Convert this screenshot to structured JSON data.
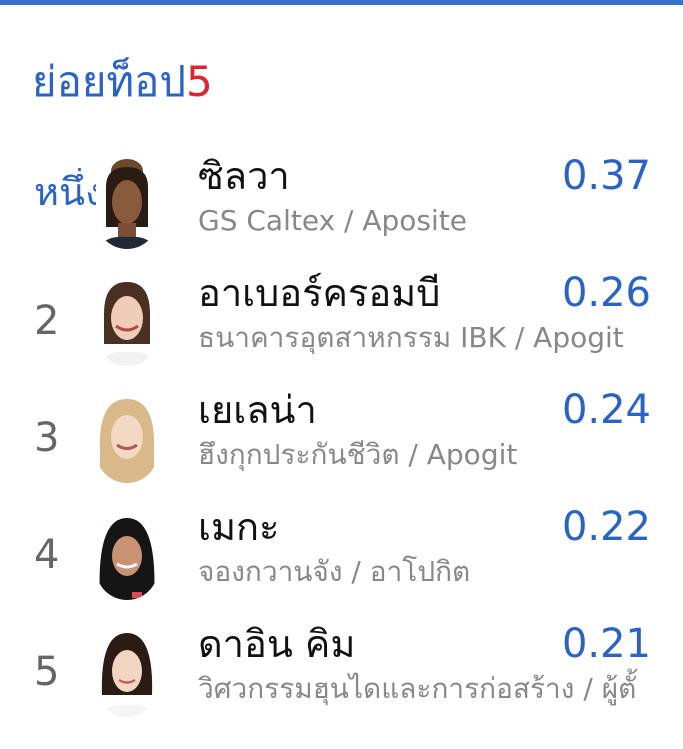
{
  "header": {
    "title": "ย่อยท็อป",
    "title_number": "5"
  },
  "rows": [
    {
      "rank": "หนึ่ง",
      "name": "ซิลวา",
      "team": "GS Caltex / Aposite",
      "value": "0.37"
    },
    {
      "rank": "2",
      "name": "อาเบอร์ครอมบี",
      "team": "ธนาคารอุตสาหกรรม IBK / Apogit",
      "value": "0.26"
    },
    {
      "rank": "3",
      "name": "เยเลน่า",
      "team": "ฮึงกุกประกันชีวิต / Apogit",
      "value": "0.24"
    },
    {
      "rank": "4",
      "name": "เมกะ",
      "team": "จองกวานจัง / อาโปกิต",
      "value": "0.22"
    },
    {
      "rank": "5",
      "name": "ดาอิน คิม",
      "team": "วิศวกรรมฮุนไดและการก่อสร้าง / ผู้ตั้",
      "value": "0.21"
    }
  ]
}
